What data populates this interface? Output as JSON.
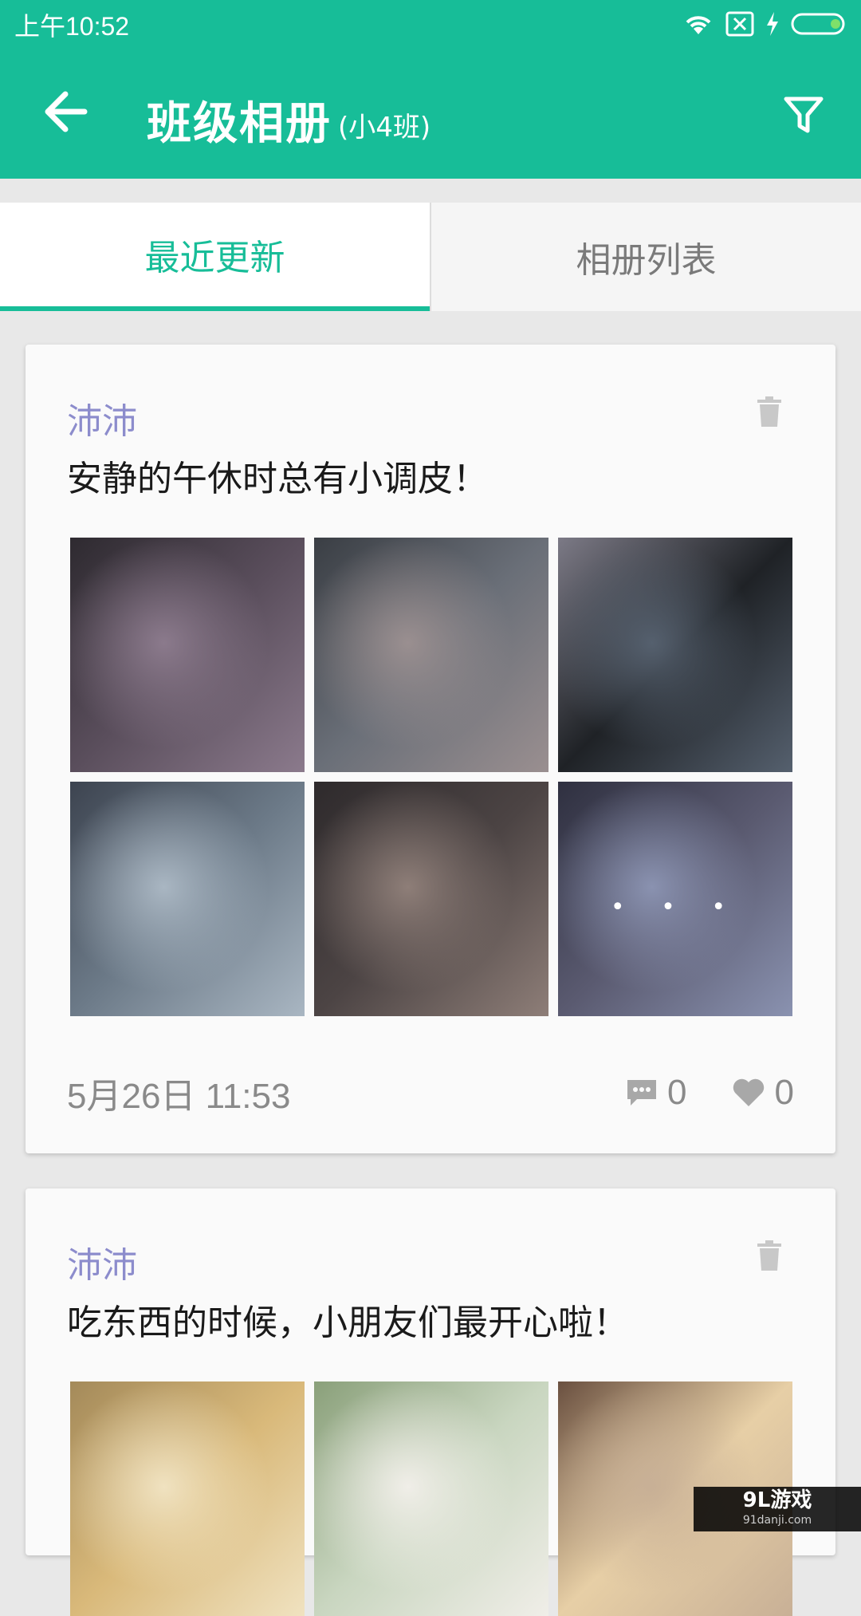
{
  "status_bar": {
    "time": "上午10:52"
  },
  "app_bar": {
    "title": "班级相册",
    "subtitle": "(小4班)"
  },
  "tabs": [
    {
      "label": "最近更新",
      "active": true
    },
    {
      "label": "相册列表",
      "active": false
    }
  ],
  "posts": [
    {
      "author": "沛沛",
      "caption": "安静的午休时总有小调皮！",
      "photos": [
        {
          "desc": "sleeping child under blanket",
          "colors": [
            "#5a4e5c",
            "#8b7a8c",
            "#2e2a30"
          ]
        },
        {
          "desc": "child sleeping close-up",
          "colors": [
            "#6a6f78",
            "#9a8f90",
            "#3a3e44"
          ]
        },
        {
          "desc": "child sleeping in dark",
          "colors": [
            "#1f2226",
            "#55606e",
            "#7c7a86"
          ]
        },
        {
          "desc": "child under blue blanket",
          "colors": [
            "#6c7a88",
            "#a9b6c2",
            "#3d4450"
          ]
        },
        {
          "desc": "child with hands on face",
          "colors": [
            "#4c4444",
            "#8e7e78",
            "#2e2a2c"
          ]
        },
        {
          "desc": "sleeping child more",
          "colors": [
            "#5a5a70",
            "#8a92b0",
            "#2f3040"
          ]
        }
      ],
      "more_indicator": "• • •",
      "date": "5月26日 11:53",
      "comments": "0",
      "likes": "0"
    },
    {
      "author": "沛沛",
      "caption": "吃东西的时候，小朋友们最开心啦！",
      "photos": [
        {
          "desc": "classroom",
          "colors": [
            "#d9b97a",
            "#f0e2c0",
            "#a48a5a"
          ]
        },
        {
          "desc": "children at table",
          "colors": [
            "#c9d6c0",
            "#f0eee8",
            "#8aa07a"
          ]
        },
        {
          "desc": "two girls",
          "colors": [
            "#e7cfa6",
            "#c8b096",
            "#6a5040"
          ]
        }
      ]
    }
  ],
  "watermark": {
    "main": "9L游戏",
    "sub": "91danji.com"
  },
  "colors": {
    "accent": "#17bd98",
    "author": "#8c8ccc"
  }
}
